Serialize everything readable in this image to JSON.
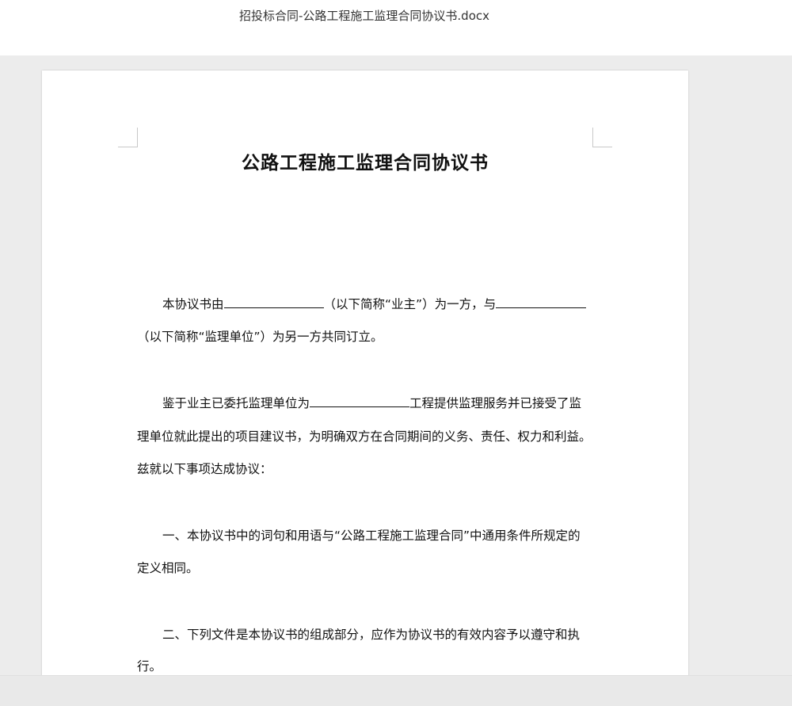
{
  "window": {
    "file_title": "招投标合同-公路工程施工监理合同协议书.docx"
  },
  "document": {
    "title": "公路工程施工监理合同协议书",
    "p1_line1_a": "本协议书由",
    "p1_line1_b": "（以下简称“业主”）为一方，与",
    "p1_line2": "（以下简称“监理单位”）为另一方共同订立。",
    "p2_line1_a": "鉴于业主已委托监理单位为",
    "p2_line1_b": "工程提供监理服务并已接受了监",
    "p2_line2": "理单位就此提出的项目建议书，为明确双方在合同期间的义务、责任、权力和利益。",
    "p2_line3": "兹就以下事项达成协议：",
    "p3_line1": "一、本协议书中的词句和用语与“公路工程施工监理合同”中通用条件所规定的",
    "p3_line2": "定义相同。",
    "p4_line1": "二、下列文件是本协议书的组成部分，应作为协议书的有效内容予以遵守和执",
    "p4_line2": "行。"
  }
}
